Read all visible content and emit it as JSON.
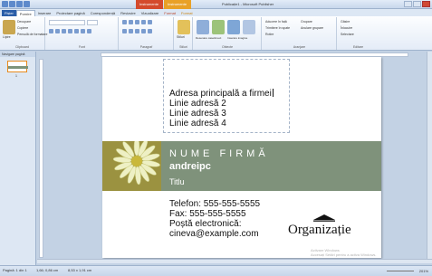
{
  "window": {
    "context_tab_1": "Instrumente casetă text",
    "context_tab_2": "Instrumente imagine",
    "doc_title": "Publicație1 - Microsoft Publisher"
  },
  "tabs": [
    "Fișier",
    "Pornire",
    "Inserare",
    "Proiectare pagină",
    "Corespondență",
    "Revizuire",
    "Vizualizare",
    "Format",
    "Format"
  ],
  "ribbon": {
    "groups": [
      "Clipboard",
      "Font",
      "Paragraf",
      "Stiluri",
      "Obiecte",
      "Aranjare",
      "Editare"
    ],
    "paste_label": "Lipire",
    "cut_label": "Decupare",
    "copy_label": "Copiere",
    "format_painter_label": "Pensulă de formatare",
    "styles_label": "Stiluri",
    "draw_textbox_label": "Desenare casetă text",
    "insert_picture_label": "Inserare imagine",
    "wrap_text_label": "Încadrare text",
    "bring_forward_label": "Aducere în față",
    "send_backward_label": "Trimitere în spate",
    "group_label": "Grupare",
    "ungroup_label": "Anulare grupare",
    "rotate_label": "Rotire",
    "find_label": "Găsire",
    "replace_label": "Înlocuire",
    "select_label": "Selectare"
  },
  "navpane": {
    "header": "Navigare pagină",
    "page_number": "1"
  },
  "card": {
    "address_lines": [
      "Adresa principală a firmei",
      "Linie adresă 2",
      "Linie adresă 3",
      "Linie adresă 4"
    ],
    "firm_name": "NUME FIRMĂ",
    "user": "andreipc",
    "title": "Titlu",
    "contact_lines": [
      "Telefon: 555-555-5555",
      "Fax: 555-555-5555",
      "Poștă electronică:",
      "cineva@example.com"
    ],
    "organization": "Organizație",
    "watermark_line1": "Activare Windows",
    "watermark_line2": "Accesați Setări pentru a activa Windows."
  },
  "status": {
    "page": "Pagină: 1 din 1",
    "position": "1,66; 0,86 cm",
    "size": "8,53 x 1,91 cm",
    "zoom": "201%"
  },
  "colors": {
    "band": "#7f927b",
    "accent_file": "#2a5ea8",
    "context_text": "#d44a2c",
    "context_picture": "#e9a126"
  }
}
